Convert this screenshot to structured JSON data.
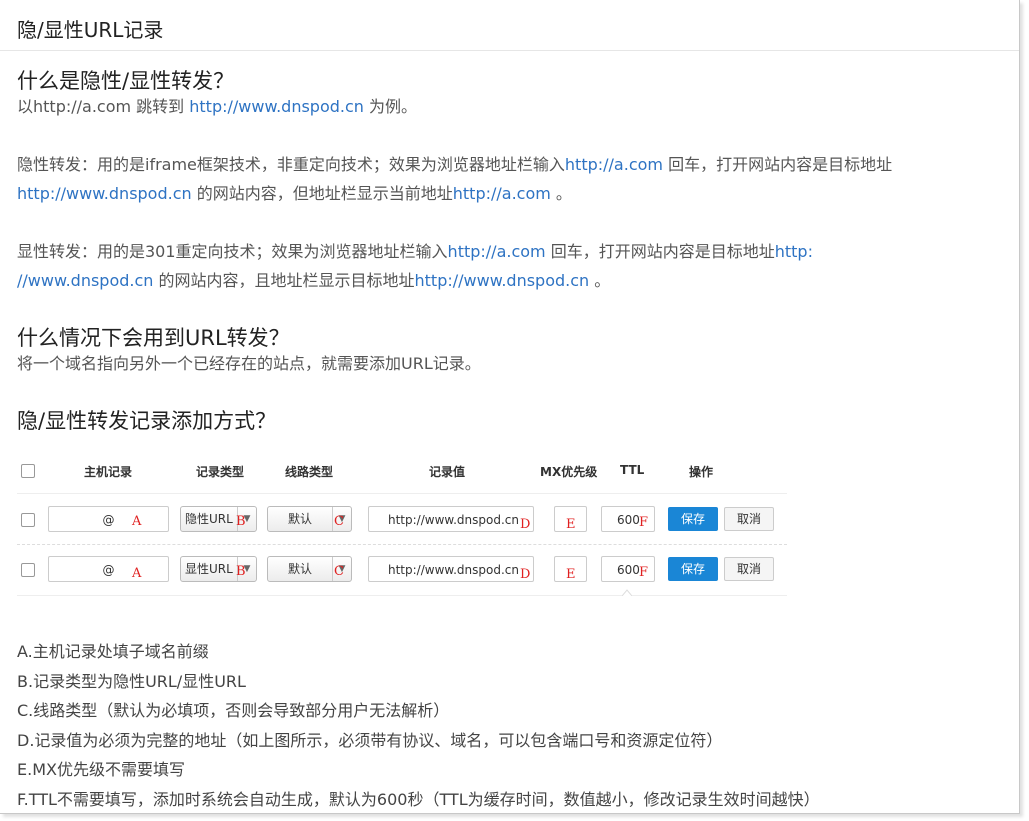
{
  "page_title": "隐/显性URL记录",
  "section1": {
    "heading": "什么是隐性/显性转发？",
    "example_pre": "以http://a.com 跳转到 ",
    "example_link": "http://www.dnspod.cn",
    "example_post": " 为例。",
    "implicit_pre": "隐性转发：用的是iframe框架技术，非重定向技术；效果为浏览器地址栏输入",
    "implicit_link1": "http://a.com",
    "implicit_mid": " 回车，打开网站内容是目标地址",
    "implicit_link2": "http://www.dnspod.cn",
    "implicit_mid2": " 的网站内容，但地址栏显示当前地址",
    "implicit_link3": "http://a.com",
    "implicit_end": " 。",
    "explicit_pre": "显性转发：用的是301重定向技术；效果为浏览器地址栏输入",
    "explicit_link1": "http://a.com",
    "explicit_mid": " 回车，打开网站内容是目标地址",
    "explicit_link2a": "http:",
    "explicit_link2b": "//www.dnspod.cn",
    "explicit_mid2": " 的网站内容，且地址栏显示目标地址",
    "explicit_link3": "http://www.dnspod.cn",
    "explicit_end": " 。"
  },
  "section2": {
    "heading": "什么情况下会用到URL转发？",
    "text": "将一个域名指向另外一个已经存在的站点，就需要添加URL记录。"
  },
  "section3": {
    "heading": "隐/显性转发记录添加方式？"
  },
  "table": {
    "headers": [
      "主机记录",
      "记录类型",
      "线路类型",
      "记录值",
      "MX优先级",
      "TTL",
      "操作"
    ],
    "rows": [
      {
        "host": "@",
        "type": "隐性URL",
        "line": "默认",
        "value": "http://www.dnspod.cn",
        "mx": "",
        "ttl": "600",
        "save": "保存",
        "cancel": "取消"
      },
      {
        "host": "@",
        "type": "显性URL",
        "line": "默认",
        "value": "http://www.dnspod.cn",
        "mx": "",
        "ttl": "600",
        "save": "保存",
        "cancel": "取消"
      }
    ],
    "markers": [
      "A",
      "B",
      "C",
      "D",
      "E",
      "F"
    ]
  },
  "notes": [
    "A.主机记录处填子域名前缀",
    "B.记录类型为隐性URL/显性URL",
    "C.线路类型（默认为必填项，否则会导致部分用户无法解析）",
    "D.记录值为必须为完整的地址（如上图所示，必须带有协议、域名，可以包含端口号和资源定位符）",
    "E.MX优先级不需要填写",
    "F.TTL不需要填写，添加时系统会自动生成，默认为600秒（TTL为缓存时间，数值越小，修改记录生效时间越快）"
  ]
}
